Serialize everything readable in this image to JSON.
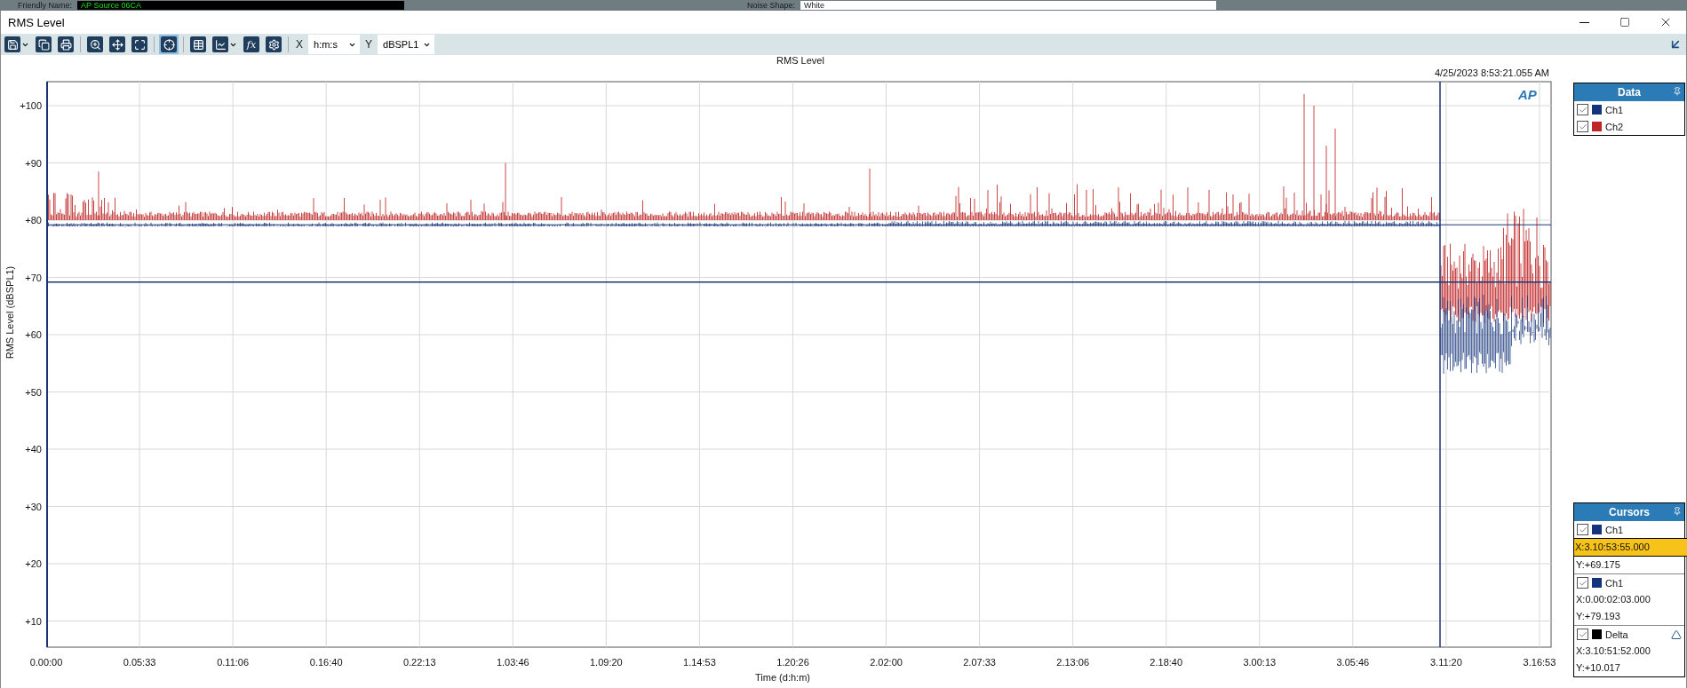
{
  "background": {
    "fields": [
      {
        "label": "Friendly Name:",
        "value": "AP Source 06CA",
        "kind": "dark"
      },
      {
        "label": "Noise Shape:",
        "value": "White",
        "kind": "dropdown"
      }
    ]
  },
  "window": {
    "title": "RMS Level"
  },
  "toolbar": {
    "tools": [
      {
        "kind": "save",
        "dropdown": true,
        "selected": false
      },
      {
        "kind": "copy",
        "dropdown": false,
        "selected": false
      },
      {
        "kind": "print",
        "dropdown": false,
        "selected": false
      },
      {
        "kind": "zoom",
        "dropdown": false,
        "selected": false
      },
      {
        "kind": "pan",
        "dropdown": false,
        "selected": false
      },
      {
        "kind": "fit",
        "dropdown": false,
        "selected": false
      },
      {
        "kind": "cursor",
        "dropdown": false,
        "selected": true
      },
      {
        "kind": "table",
        "dropdown": false,
        "selected": false
      },
      {
        "kind": "graph",
        "dropdown": true,
        "selected": false
      },
      {
        "kind": "function",
        "dropdown": false,
        "selected": false,
        "text": "fx"
      },
      {
        "kind": "settings",
        "dropdown": false,
        "selected": false
      }
    ],
    "x_axis": {
      "label": "X",
      "value": "h:m:s"
    },
    "y_axis": {
      "label": "Y",
      "value": "dBSPL1"
    }
  },
  "graph": {
    "title": "RMS Level",
    "timestamp": "4/25/2023 8:53:21.055 AM",
    "logo": "AP",
    "ylabel": "RMS Level (dBSPL1)",
    "xlabel": "Time (d:h:m)",
    "yticks": [
      "+100",
      "+90",
      "+80",
      "+70",
      "+60",
      "+50",
      "+40",
      "+30",
      "+20",
      "+10"
    ],
    "xticks": [
      "0.00:00",
      "0.05:33",
      "0.11:06",
      "0.16:40",
      "0.22:13",
      "1.03:46",
      "1.09:20",
      "1.14:53",
      "1.20:26",
      "2.02:00",
      "2.07:33",
      "2.13:06",
      "2.18:40",
      "3.00:13",
      "3.05:46",
      "3.11:20",
      "3.16:53"
    ]
  },
  "data_panel": {
    "title": "Data",
    "items": [
      {
        "label": "Ch1",
        "checked": true,
        "color": "#13337a"
      },
      {
        "label": "Ch2",
        "checked": true,
        "color": "#c02424"
      }
    ]
  },
  "cursors_panel": {
    "title": "Cursors",
    "items": [
      {
        "kind": "cursor",
        "label": "Ch1",
        "checked": true,
        "color": "#13337a",
        "x": "X:3.10:53:55.000",
        "x_highlighted": true,
        "y": "Y:+69.175"
      },
      {
        "kind": "cursor",
        "label": "Ch1",
        "checked": true,
        "color": "#13337a",
        "x": "X:0.00:02:03.000",
        "x_highlighted": false,
        "y": "Y:+79.193"
      },
      {
        "kind": "delta",
        "label": "Delta",
        "checked": true,
        "color": "#000000",
        "x": "X:3.10:51:52.000",
        "x_highlighted": false,
        "y": "Y:+10.017"
      }
    ]
  }
}
